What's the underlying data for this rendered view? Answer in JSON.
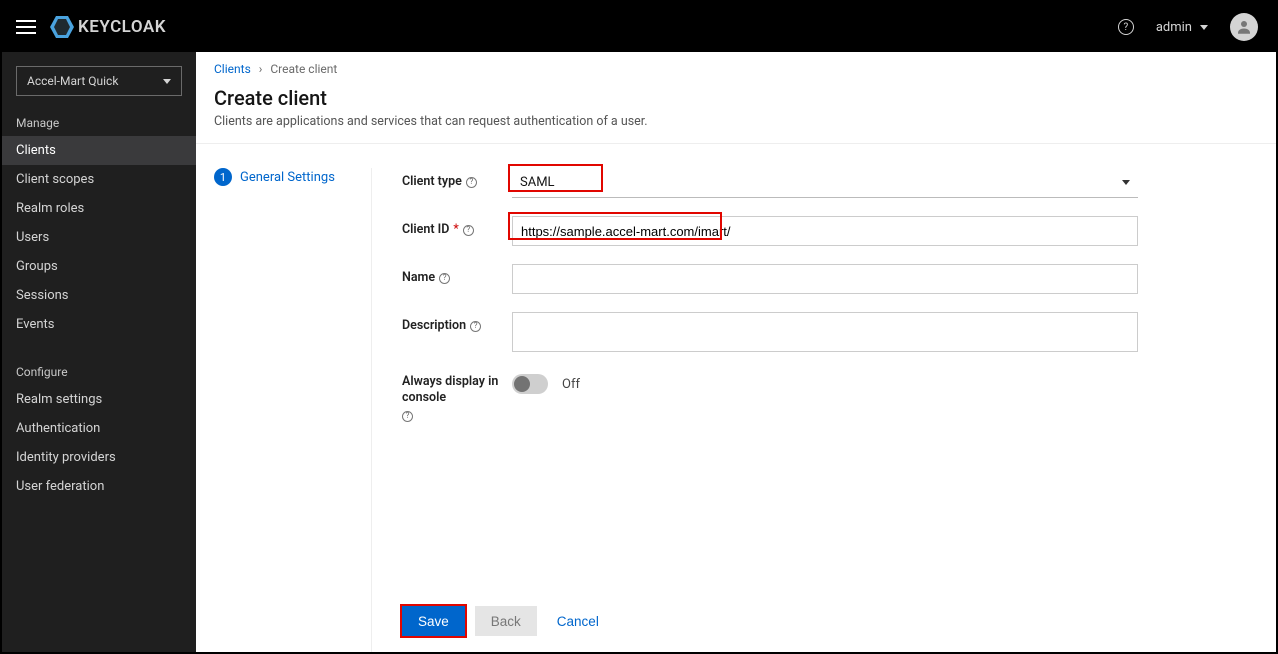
{
  "app_name": "KEYCLOAK",
  "header": {
    "username": "admin"
  },
  "sidebar": {
    "realm_selected": "Accel-Mart Quick",
    "sections": {
      "manage_title": "Manage",
      "manage": [
        {
          "key": "clients",
          "label": "Clients",
          "active": true
        },
        {
          "key": "client-scopes",
          "label": "Client scopes",
          "active": false
        },
        {
          "key": "realm-roles",
          "label": "Realm roles",
          "active": false
        },
        {
          "key": "users",
          "label": "Users",
          "active": false
        },
        {
          "key": "groups",
          "label": "Groups",
          "active": false
        },
        {
          "key": "sessions",
          "label": "Sessions",
          "active": false
        },
        {
          "key": "events",
          "label": "Events",
          "active": false
        }
      ],
      "configure_title": "Configure",
      "configure": [
        {
          "key": "realm-settings",
          "label": "Realm settings"
        },
        {
          "key": "authentication",
          "label": "Authentication"
        },
        {
          "key": "identity-providers",
          "label": "Identity providers"
        },
        {
          "key": "user-federation",
          "label": "User federation"
        }
      ]
    }
  },
  "breadcrumb": {
    "parent": "Clients",
    "current": "Create client"
  },
  "page": {
    "title": "Create client",
    "description": "Clients are applications and services that can request authentication of a user."
  },
  "wizard": {
    "step_num": "1",
    "step_label": "General Settings"
  },
  "form": {
    "client_type": {
      "label": "Client type",
      "value": "SAML"
    },
    "client_id": {
      "label": "Client ID",
      "value": "https://sample.accel-mart.com/imart/"
    },
    "name": {
      "label": "Name",
      "value": ""
    },
    "description": {
      "label": "Description",
      "value": ""
    },
    "always_display": {
      "label": "Always display in console",
      "state": "Off"
    }
  },
  "buttons": {
    "save": "Save",
    "back": "Back",
    "cancel": "Cancel"
  }
}
